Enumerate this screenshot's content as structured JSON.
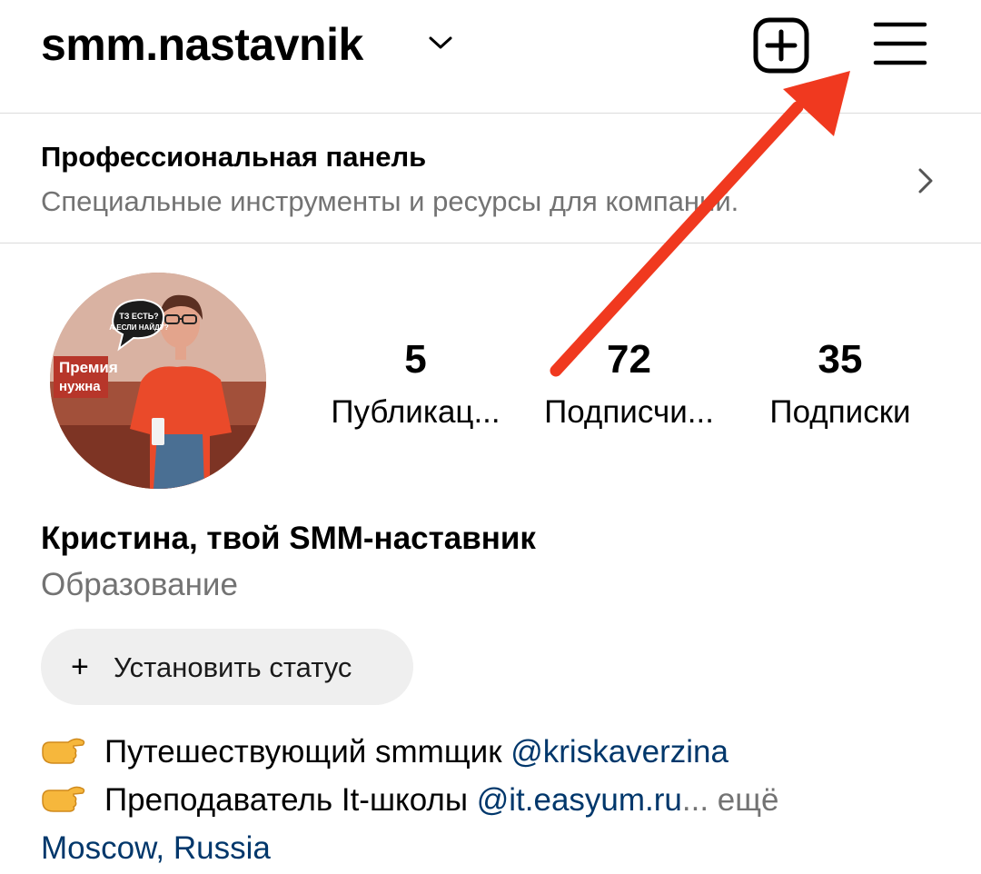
{
  "header": {
    "username": "smm.nastavnik",
    "icons": {
      "account_switch": "chevron-down-icon",
      "create": "plus-square-icon",
      "menu": "hamburger-menu-icon"
    }
  },
  "pro_panel": {
    "title": "Профессиональная панель",
    "subtitle": "Специальные инструменты и ресурсы для компаний."
  },
  "stats": [
    {
      "value": "5",
      "label": "Публикац..."
    },
    {
      "value": "72",
      "label": "Подписчи..."
    },
    {
      "value": "35",
      "label": "Подписки"
    }
  ],
  "avatar": {
    "sign_text": "ТЗ ЕСТЬ? А ЕСЛИ НАЙДУ?",
    "background_text": "Премия нужна"
  },
  "profile": {
    "name": "Кристина, твой SMM-наставник",
    "category": "Образование"
  },
  "status_button": {
    "plus": "+",
    "label": "Установить статус"
  },
  "bio": [
    {
      "emoji": "pointing-hand-icon",
      "text": "Путешествующий smmщик ",
      "link": "@kriskaverzina",
      "more": ""
    },
    {
      "emoji": "pointing-hand-icon",
      "text": "Преподаватель It-школы ",
      "link": "@it.easyum.ru",
      "more": "... ещё"
    }
  ],
  "location": "Moscow, Russia",
  "colors": {
    "link": "#00376b",
    "secondary_text": "#737373",
    "divider": "#dbdbdb",
    "annotation_arrow": "#f0391f",
    "status_bg": "#efefef"
  }
}
